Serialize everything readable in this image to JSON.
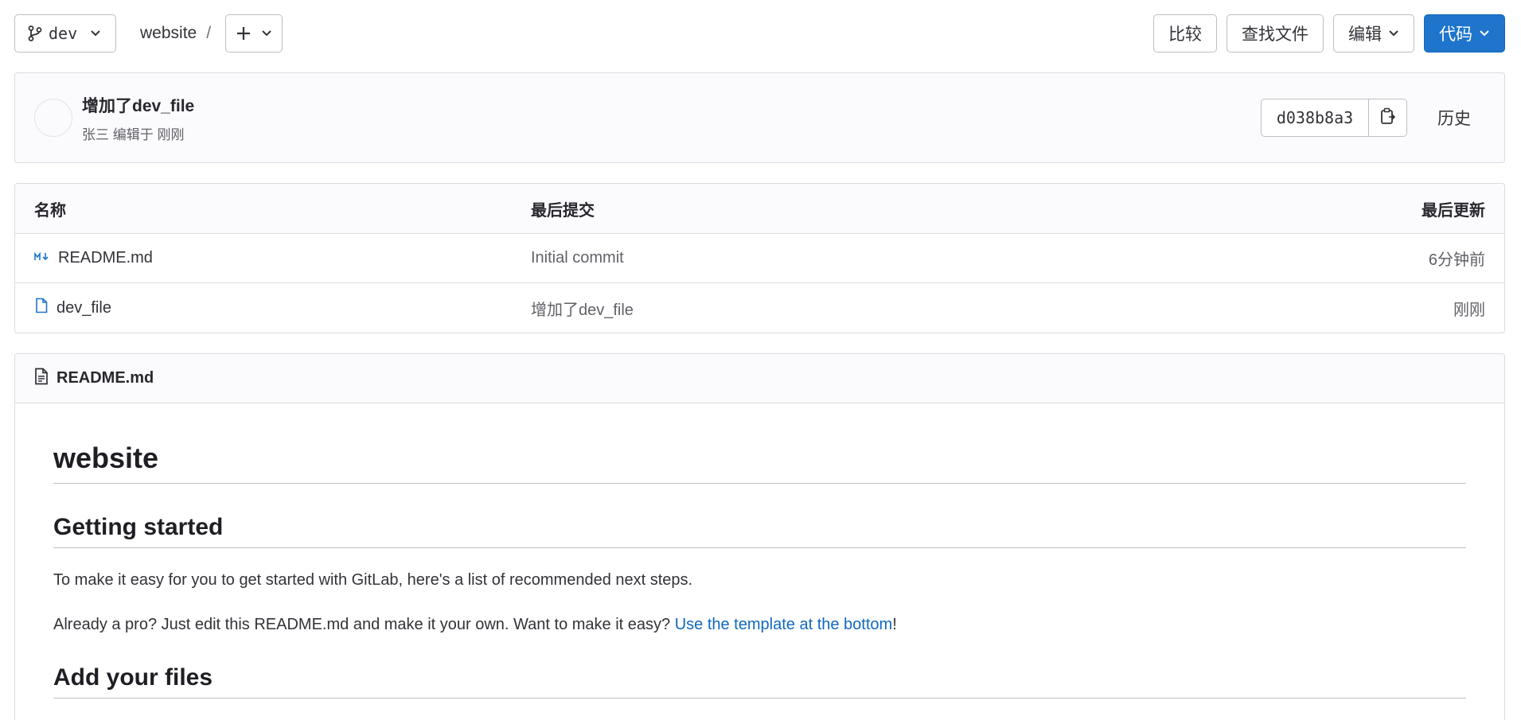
{
  "toolbar": {
    "branch": "dev",
    "project": "website",
    "separator": "/",
    "plus_symbol": "+",
    "compare_label": "比较",
    "find_file_label": "查找文件",
    "edit_label": "编辑",
    "code_label": "代码"
  },
  "commit": {
    "title": "增加了dev_file",
    "meta": "张三 编辑于 刚刚",
    "sha": "d038b8a3",
    "history_label": "历史"
  },
  "table": {
    "headers": {
      "name": "名称",
      "last_commit": "最后提交",
      "last_update": "最后更新"
    },
    "rows": [
      {
        "name": "README.md",
        "icon": "markdown-icon",
        "commit": "Initial commit",
        "updated": "6分钟前"
      },
      {
        "name": "dev_file",
        "icon": "file-icon",
        "commit": "增加了dev_file",
        "updated": "刚刚"
      }
    ]
  },
  "readme": {
    "filename": "README.md",
    "h1": "website",
    "h2_getting_started": "Getting started",
    "p1": "To make it easy for you to get started with GitLab, here's a list of recommended next steps.",
    "p2_prefix": "Already a pro? Just edit this README.md and make it your own. Want to make it easy? ",
    "p2_link": "Use the template at the bottom",
    "p2_suffix": "!",
    "h2_add_files": "Add your files"
  },
  "colors": {
    "primary": "#1f75cb",
    "link": "#1068bf",
    "border": "#dcdcde",
    "header_bg": "#fbfafd"
  }
}
